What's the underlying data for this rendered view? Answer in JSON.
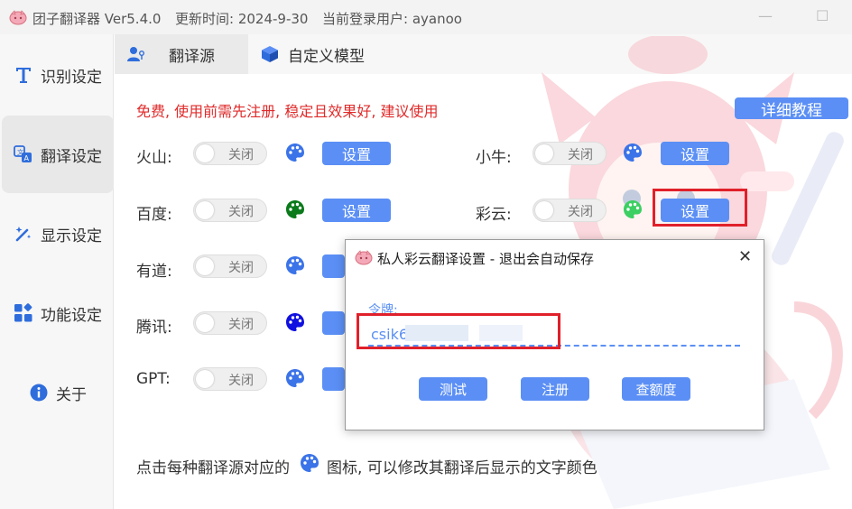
{
  "titlebar": {
    "title": "团子翻译器 Ver5.4.0",
    "update_time": "更新时间: 2024-9-30",
    "current_user": "当前登录用户: ayanoo"
  },
  "sidebar": {
    "items": [
      {
        "label": "识别设定",
        "icon": "text-t-icon"
      },
      {
        "label": "翻译设定",
        "icon": "translate-icon"
      },
      {
        "label": "显示设定",
        "icon": "magic-wand-icon"
      },
      {
        "label": "功能设定",
        "icon": "apps-grid-icon"
      },
      {
        "label": "关于",
        "icon": "info-icon"
      }
    ]
  },
  "tabs": [
    {
      "label": "翻译源",
      "icon": "user-key-icon"
    },
    {
      "label": "自定义模型",
      "icon": "cube-icon"
    }
  ],
  "notice": "免费, 使用前需先注册, 稳定且效果好, 建议使用",
  "tutorial_button": "详细教程",
  "sources_left": [
    {
      "name": "火山:",
      "toggle": "关闭",
      "palette_color": "#3b73e8"
    },
    {
      "name": "百度:",
      "toggle": "关闭",
      "palette_color": "#0a7a1a"
    },
    {
      "name": "有道:",
      "toggle": "关闭",
      "palette_color": "#3b73e8"
    },
    {
      "name": "腾讯:",
      "toggle": "关闭",
      "palette_color": "#1010e0"
    },
    {
      "name": "GPT:",
      "toggle": "关闭",
      "palette_color": "#3b73e8"
    }
  ],
  "sources_right": [
    {
      "name": "小牛:",
      "toggle": "关闭",
      "palette_color": "#3b73e8"
    },
    {
      "name": "彩云:",
      "toggle": "关闭",
      "palette_color": "#3ccf62"
    }
  ],
  "set_button_label": "设置",
  "hint": {
    "before": "点击每种翻译源对应的",
    "after": "图标, 可以修改其翻译后显示的文字颜色"
  },
  "dialog": {
    "title": "私人彩云翻译设置 - 退出会自动保存",
    "close": "✕",
    "token_label": "令牌:",
    "token_value": "csik6",
    "buttons": {
      "test": "测试",
      "register": "注册",
      "quota": "查额度"
    }
  },
  "colors": {
    "accent": "#5b8ff5",
    "notice_red": "#e02b2b",
    "highlight_red": "#e0202a"
  }
}
